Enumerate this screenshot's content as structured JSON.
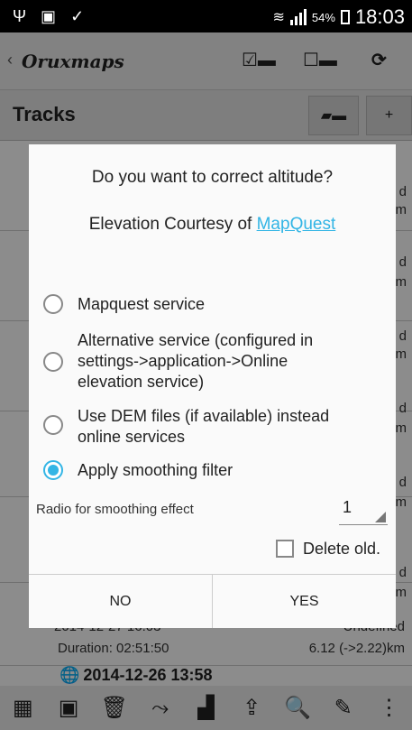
{
  "status_bar": {
    "battery_pct": "54%",
    "time": "18:03"
  },
  "app_bar": {
    "logo_a": "Oruxmaps"
  },
  "tracks_header": {
    "title": "Tracks",
    "add_label": "+"
  },
  "background": {
    "row_suffix_1": "d",
    "row_suffix_2": "m",
    "track_partial_date": "2014-12-27 16:03",
    "track_partial_status": "Undefined",
    "track_duration": "Duration: 02:51:50",
    "track_distance": "6.12 (->2.22)km",
    "next_track_date": "2014-12-26 13:58"
  },
  "dialog": {
    "title": "Do you want to correct altitude?",
    "courtesy_prefix": "Elevation Courtesy of ",
    "courtesy_link": "MapQuest",
    "options": [
      {
        "label": "Mapquest service",
        "selected": false
      },
      {
        "label": "Alternative service (configured in settings->application->Online elevation service)",
        "selected": false
      },
      {
        "label": "Use DEM files (if available) instead online services",
        "selected": false
      },
      {
        "label": "Apply smoothing filter",
        "selected": true
      }
    ],
    "smoothing_label": "Radio for smoothing effect",
    "smoothing_value": "1",
    "delete_old_label": "Delete old.",
    "delete_old_checked": false,
    "no_label": "NO",
    "yes_label": "YES"
  },
  "colors": {
    "accent": "#33b5e5"
  }
}
